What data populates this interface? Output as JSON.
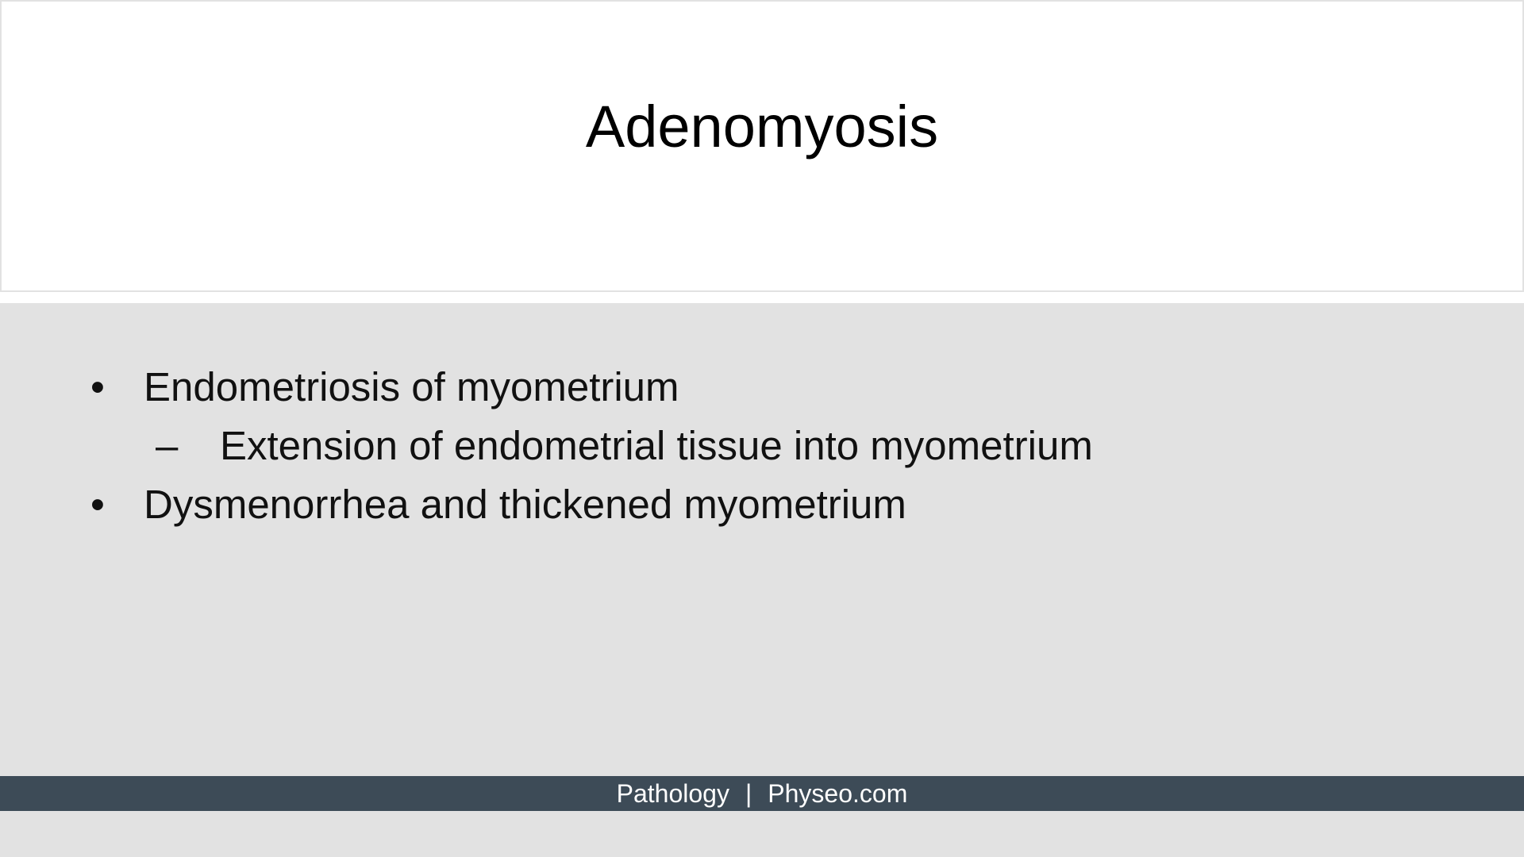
{
  "slide": {
    "title": "Adenomyosis",
    "bullets": [
      {
        "marker": "•",
        "text": "Endometriosis of myometrium"
      },
      {
        "marker": "–",
        "text": "Extension of endometrial tissue into myometrium"
      },
      {
        "marker": "•",
        "text": "Dysmenorrhea and thickened myometrium"
      }
    ]
  },
  "footer": {
    "subject": "Pathology",
    "separator": "|",
    "site": "Physeo.com"
  },
  "colors": {
    "background": "#e2e2e2",
    "title_box": "#ffffff",
    "footer_bar": "#3d4b57",
    "footer_text": "#ffffff"
  }
}
